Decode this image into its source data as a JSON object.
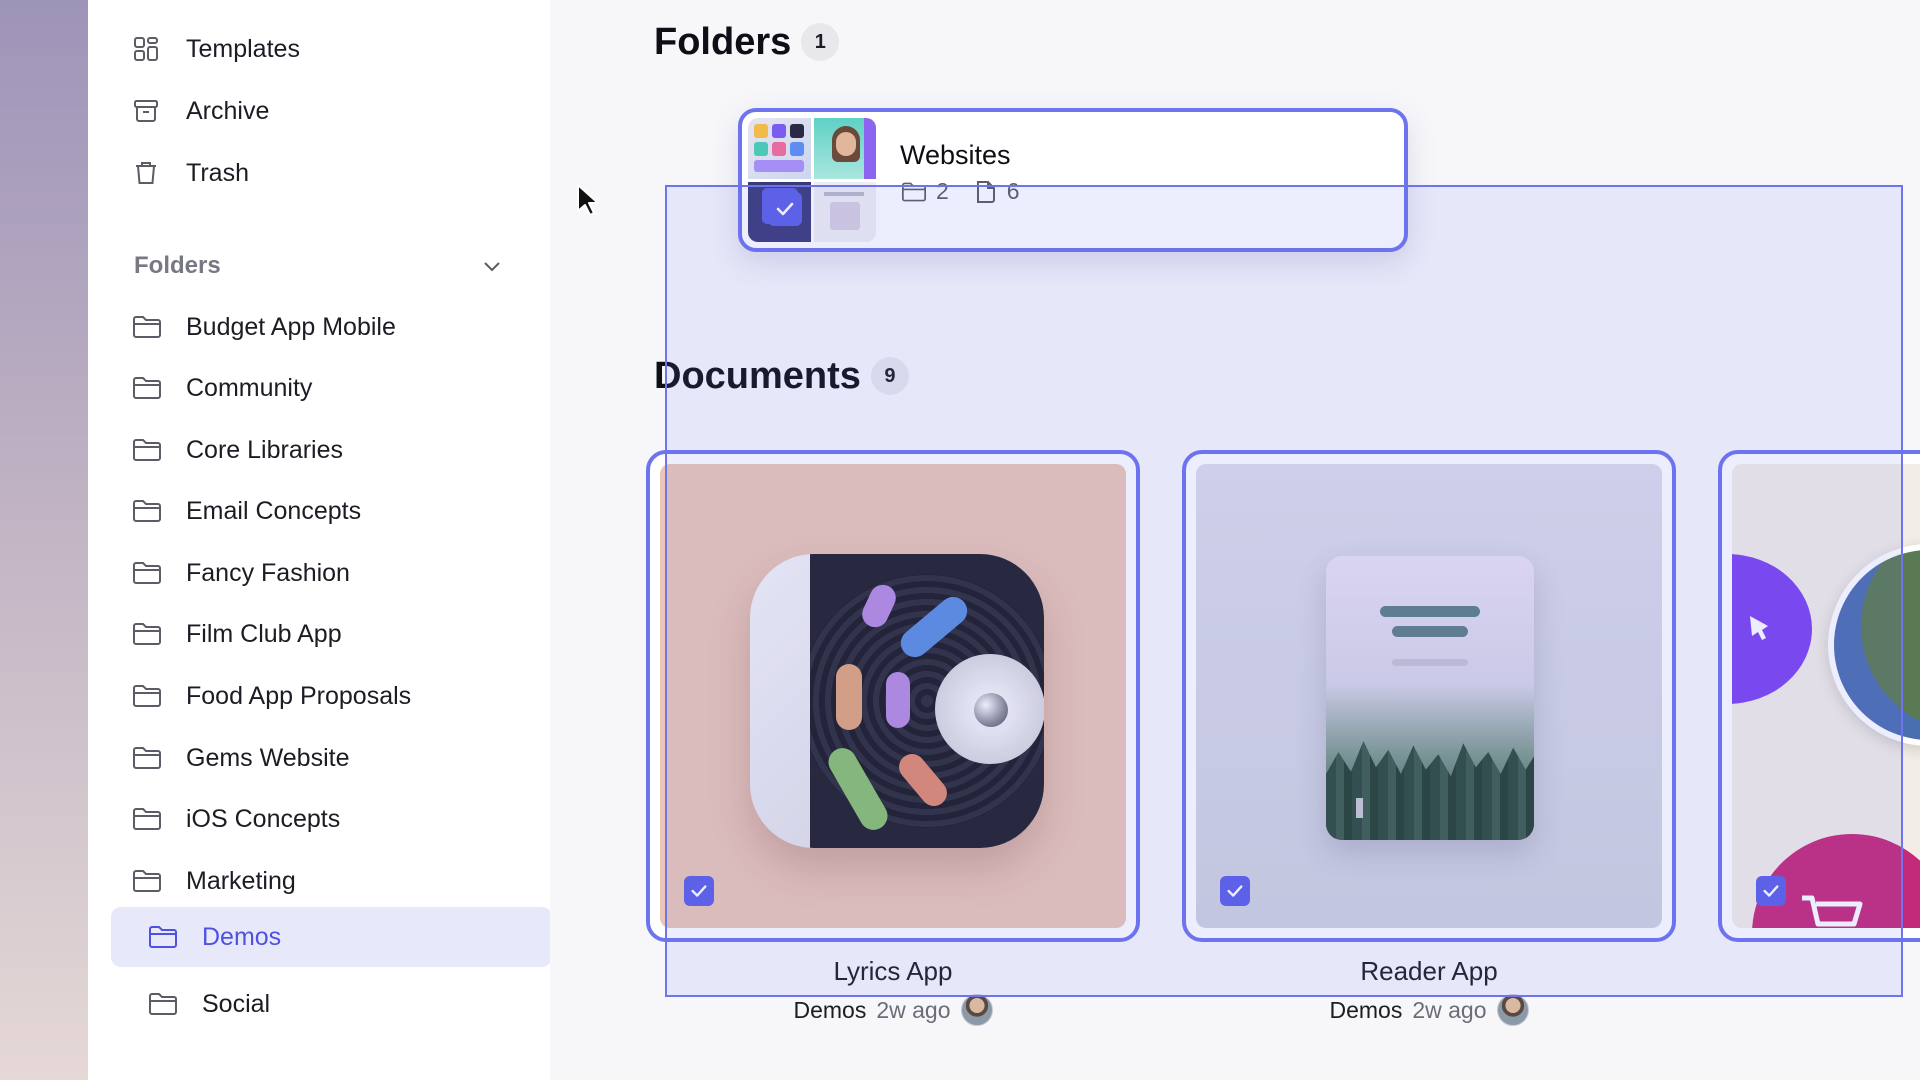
{
  "sidebar": {
    "nav": [
      {
        "label": "Templates",
        "icon": "templates-icon"
      },
      {
        "label": "Archive",
        "icon": "archive-icon"
      },
      {
        "label": "Trash",
        "icon": "trash-icon"
      }
    ],
    "folders_heading": "Folders",
    "folders": [
      {
        "label": "Budget App Mobile"
      },
      {
        "label": "Community"
      },
      {
        "label": "Core Libraries"
      },
      {
        "label": "Email Concepts"
      },
      {
        "label": "Fancy Fashion"
      },
      {
        "label": "Film Club App"
      },
      {
        "label": "Food App Proposals"
      },
      {
        "label": "Gems Website"
      },
      {
        "label": "iOS Concepts"
      },
      {
        "label": "Marketing"
      },
      {
        "label": "Demos"
      },
      {
        "label": "Social"
      }
    ],
    "active_folder": "Demos"
  },
  "main": {
    "folders_section": {
      "title": "Folders",
      "count": "1"
    },
    "folder_cards": [
      {
        "name": "Websites",
        "subfolders": "2",
        "files": "6",
        "selected": true
      }
    ],
    "documents_section": {
      "title": "Documents",
      "count": "9"
    },
    "documents": [
      {
        "name": "Lyrics App",
        "folder": "Demos",
        "time": "2w ago",
        "selected": true
      },
      {
        "name": "Reader App",
        "folder": "Demos",
        "time": "2w ago",
        "selected": true
      },
      {
        "name": "",
        "folder": "",
        "time": "",
        "selected": true
      }
    ]
  },
  "colors": {
    "accent": "#5a5fe8",
    "selection_border": "#6e73ee",
    "active_bg": "#e8e8fb"
  }
}
